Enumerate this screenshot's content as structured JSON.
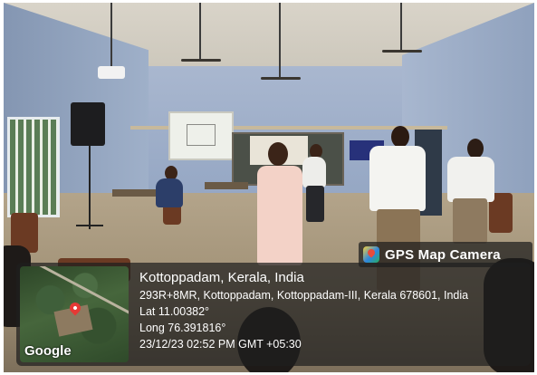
{
  "gps_badge": {
    "label": "GPS Map Camera",
    "icon": "gps-map-camera-app-icon"
  },
  "stamp": {
    "location_title": "Kottoppadam, Kerala, India",
    "address": "293R+8MR, Kottoppadam, Kottoppadam-III, Kerala 678601, India",
    "latitude": "Lat 11.00382°",
    "longitude": "Long 76.391816°",
    "datetime": "23/12/23 02:52 PM GMT +05:30"
  },
  "map": {
    "attribution": "Google",
    "pin_icon": "location-pin-icon",
    "pin_color": "#e53935"
  }
}
